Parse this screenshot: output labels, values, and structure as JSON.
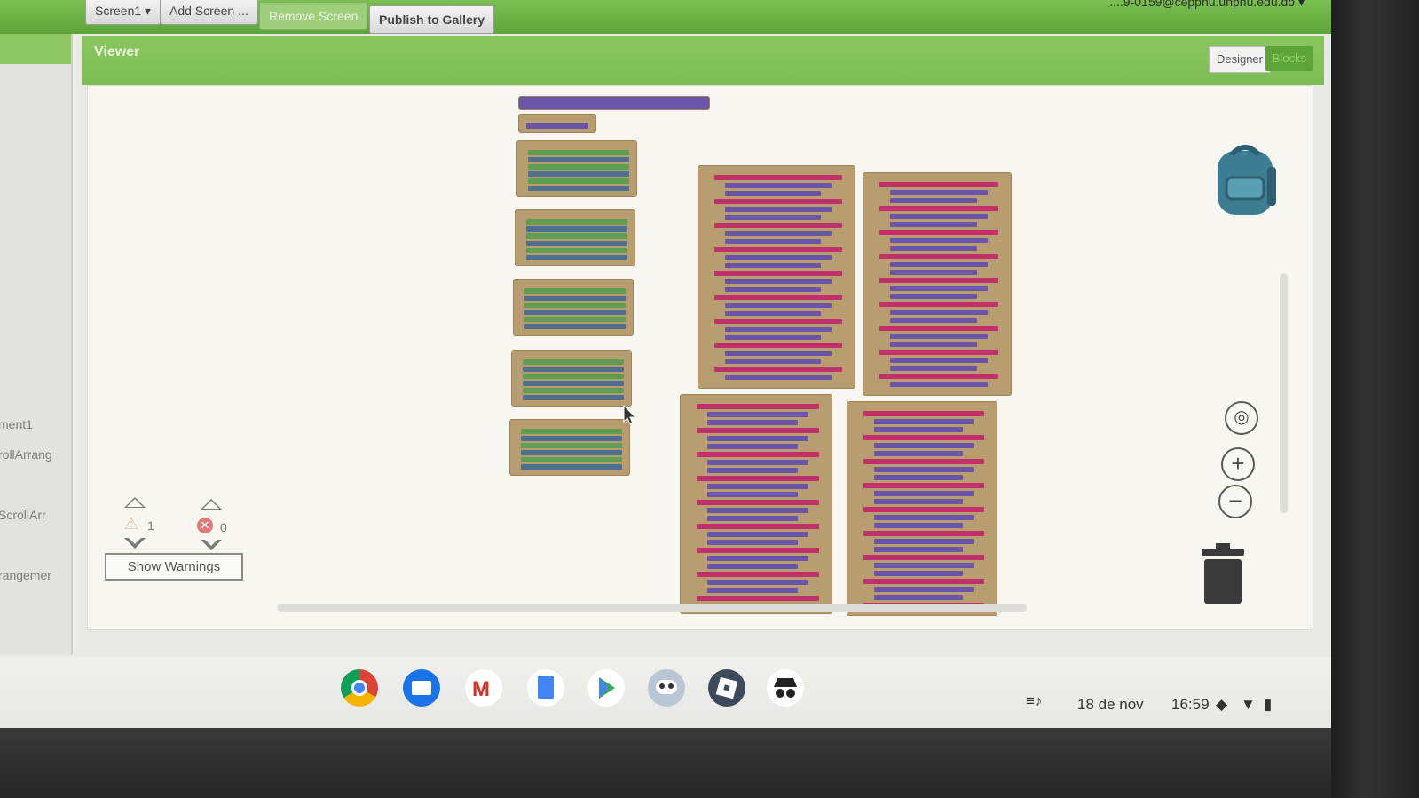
{
  "topbar": {
    "screen_select": "Screen1 ▾",
    "add_screen": "Add Screen ...",
    "remove_screen": "Remove Screen",
    "publish": "Publish to Gallery",
    "account": "....9-0159@cepphu.unphu.edu.do ▾"
  },
  "palette": {
    "labels": [
      "ment1",
      "rollArrang",
      "ScrollArr",
      "rangemer"
    ]
  },
  "viewer": {
    "title": "Viewer",
    "designer_button": "Designer",
    "blocks_button": "Blocks"
  },
  "warnings": {
    "warning_count": "1",
    "error_count": "0",
    "show_warnings": "Show Warnings"
  },
  "workspace_controls": {
    "icons": [
      "backpack-icon",
      "recenter-icon",
      "zoom-in-icon",
      "zoom-out-icon",
      "trash-icon"
    ]
  },
  "taskbar": {
    "apps": [
      "chrome",
      "files",
      "gmail",
      "docs",
      "play-store",
      "game-app",
      "roblox",
      "incognito-app"
    ],
    "date": "18 de nov",
    "time": "16:59"
  },
  "colors": {
    "topbar_green": "#5da43a",
    "viewer_green": "#7dbd54",
    "block_tan": "#b79d6f",
    "block_purple": "#6b55a8",
    "block_magenta": "#c0306a",
    "block_green": "#5f9e52"
  }
}
